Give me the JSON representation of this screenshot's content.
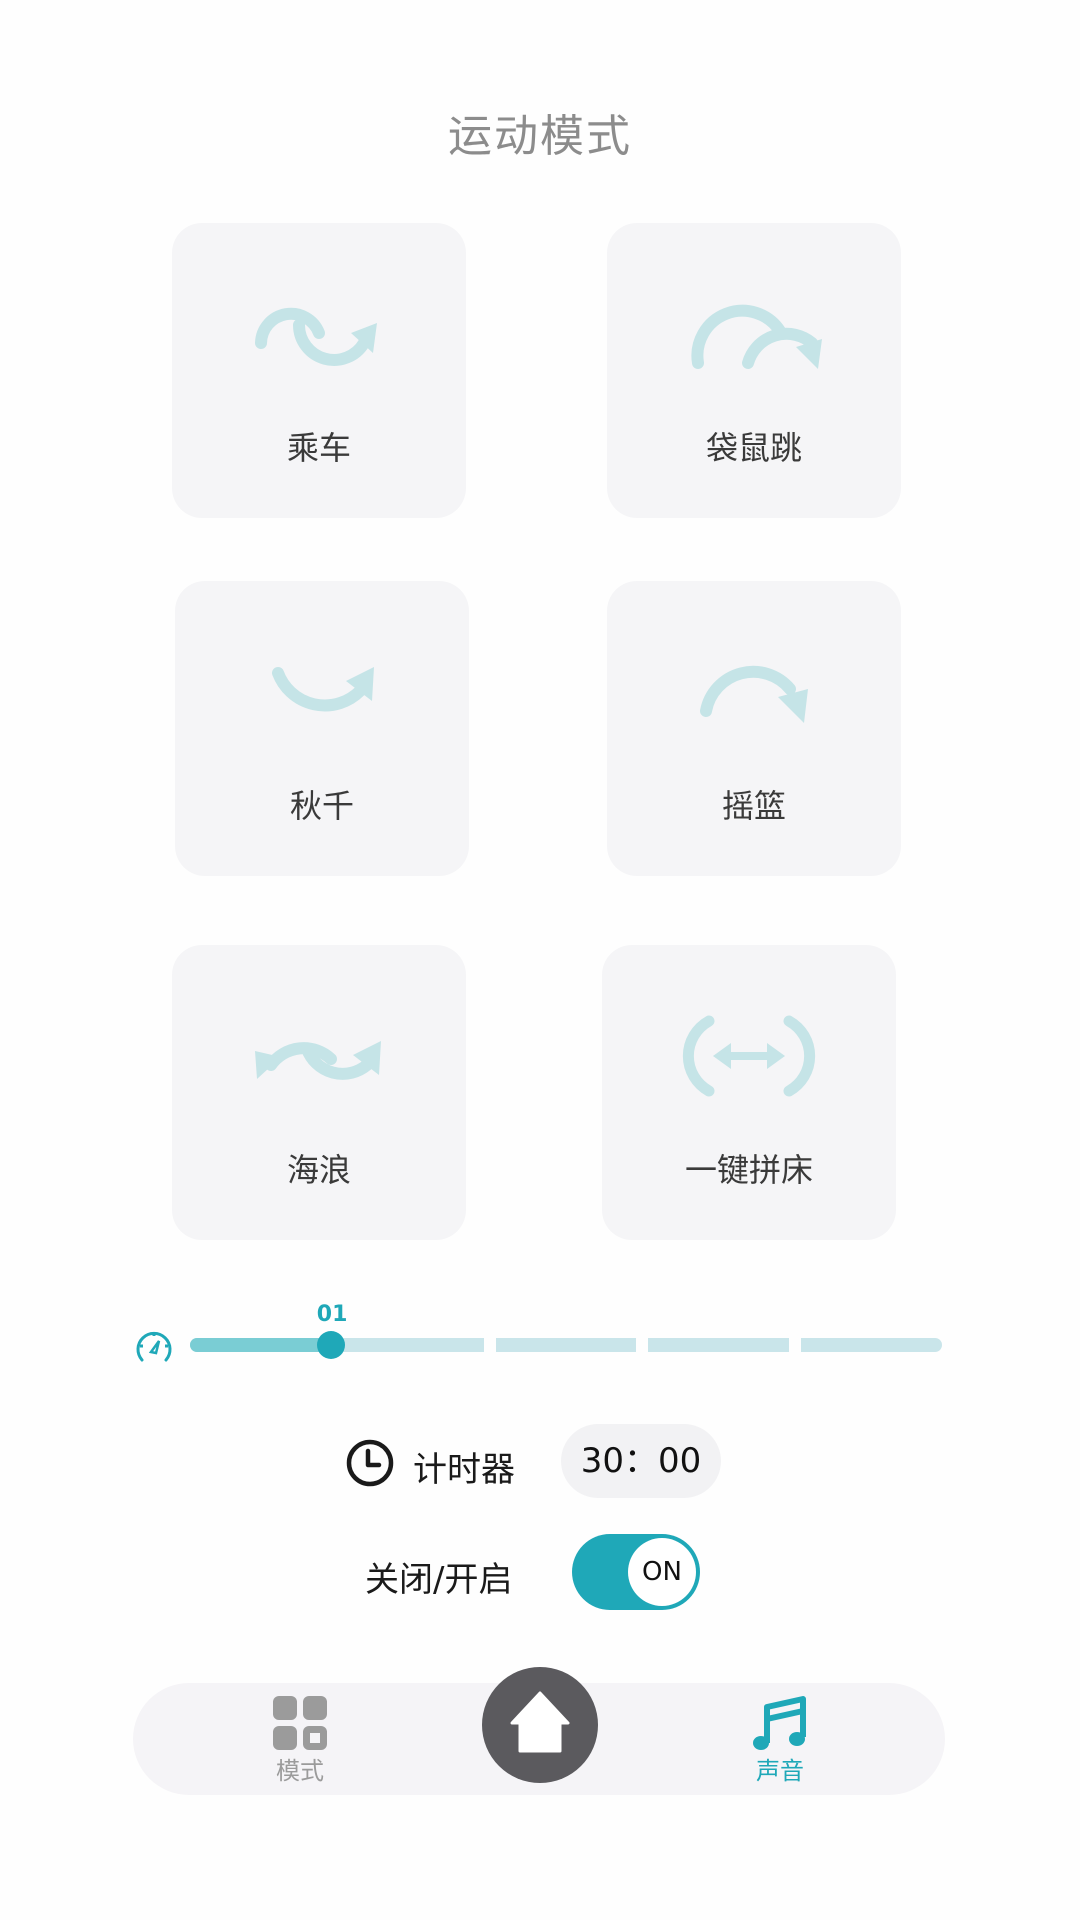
{
  "header": {
    "title": "运动模式"
  },
  "modes": [
    {
      "label": "乘车",
      "icon": "ride-wave-arrow-icon"
    },
    {
      "label": "袋鼠跳",
      "icon": "kangaroo-hop-arrow-icon"
    },
    {
      "label": "秋千",
      "icon": "swing-arrow-icon"
    },
    {
      "label": "摇篮",
      "icon": "cradle-arrow-icon"
    },
    {
      "label": "海浪",
      "icon": "wave-double-arrow-icon"
    },
    {
      "label": "一键拼床",
      "icon": "bed-merge-arrows-icon"
    }
  ],
  "speed": {
    "icon": "speedometer-icon",
    "level_label": "01",
    "level": 1,
    "max_level": 5
  },
  "timer": {
    "icon": "clock-icon",
    "label": "计时器",
    "value": "30：00"
  },
  "power": {
    "label": "关闭/开启",
    "state": "ON"
  },
  "bottom_nav": {
    "items": [
      {
        "label": "模式",
        "icon": "grid-icon",
        "active": false
      },
      {
        "label": "",
        "icon": "home-icon",
        "active": false
      },
      {
        "label": "声音",
        "icon": "music-note-icon",
        "active": true
      }
    ]
  },
  "colors": {
    "accent": "#1fa8b8",
    "icon_tint": "#c5e4e7",
    "card_bg": "#f5f5f7",
    "inactive": "#9b9b9b"
  }
}
